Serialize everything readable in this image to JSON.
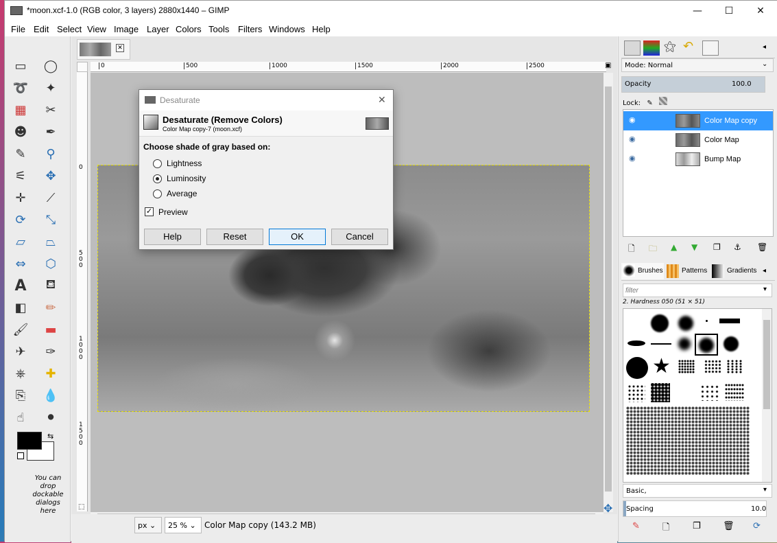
{
  "window": {
    "title": "*moon.xcf-1.0 (RGB color, 3 layers) 2880x1440 – GIMP",
    "minimize": "—",
    "maximize": "☐",
    "close": "✕"
  },
  "menu": [
    "File",
    "Edit",
    "Select",
    "View",
    "Image",
    "Layer",
    "Colors",
    "Tools",
    "Filters",
    "Windows",
    "Help"
  ],
  "toolbox": {
    "hint": "You can drop dockable dialogs here"
  },
  "ruler": {
    "h_ticks": [
      "0",
      "500",
      "1000",
      "1500",
      "2000",
      "2500"
    ],
    "v_ticks": [
      "0",
      "500",
      "1000",
      "1500"
    ]
  },
  "status": {
    "unit": "px",
    "zoom": "25 %",
    "layer_info": "Color Map copy (143.2 MB)"
  },
  "dialog": {
    "window_title": "Desaturate",
    "heading": "Desaturate (Remove Colors)",
    "subheading": "Color Map copy-7 (moon.xcf)",
    "group_label": "Choose shade of gray based on:",
    "options": [
      "Lightness",
      "Luminosity",
      "Average"
    ],
    "selected": "Luminosity",
    "preview_label": "Preview",
    "buttons": {
      "help": "Help",
      "reset": "Reset",
      "ok": "OK",
      "cancel": "Cancel"
    }
  },
  "layers_panel": {
    "mode_label": "Mode: Normal",
    "opacity_label": "Opacity",
    "opacity_value": "100.0",
    "opacity_percent": 100,
    "lock_label": "Lock:",
    "layers": [
      {
        "name": "Color Map copy",
        "selected": true
      },
      {
        "name": "Color Map",
        "selected": false
      },
      {
        "name": "Bump Map",
        "selected": false
      }
    ]
  },
  "brushes_panel": {
    "tabs": [
      "Brushes",
      "Patterns",
      "Gradients"
    ],
    "filter_placeholder": "filter",
    "current_brush": "2. Hardness 050 (51 × 51)",
    "preset": "Basic,",
    "spacing_label": "Spacing",
    "spacing_value": "10.0"
  },
  "colors": {
    "accent": "#3399ff",
    "selection": "#e7e000",
    "foreground": "#000000",
    "background": "#ffffff"
  }
}
